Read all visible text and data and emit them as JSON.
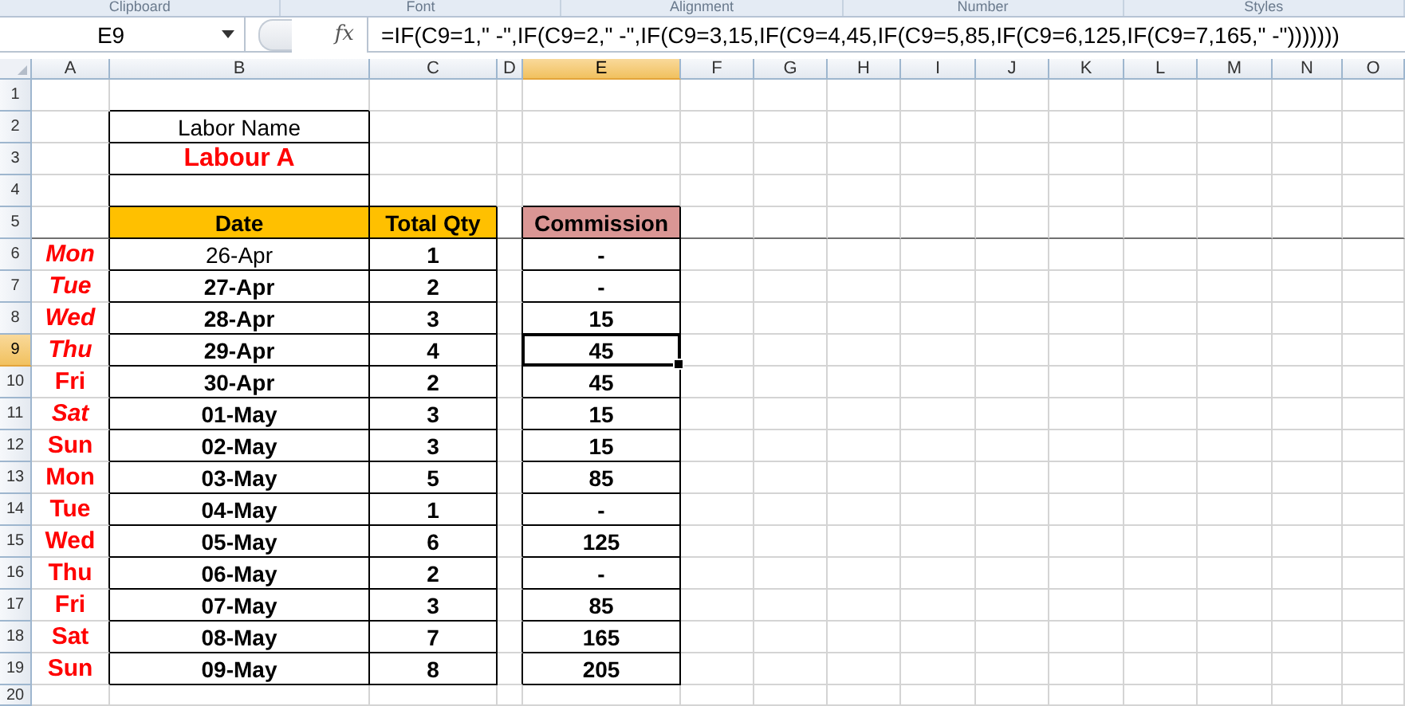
{
  "ribbon_groups": [
    "Clipboard",
    "Font",
    "Alignment",
    "Number",
    "Styles"
  ],
  "formula_bar": {
    "name_box": "E9",
    "fx_label": "fx",
    "formula": "=IF(C9=1,\" -\",IF(C9=2,\" -\",IF(C9=3,15,IF(C9=4,45,IF(C9=5,85,IF(C9=6,125,IF(C9=7,165,\" -\")))))))"
  },
  "columns": [
    {
      "label": "A",
      "selected": false
    },
    {
      "label": "B",
      "selected": false
    },
    {
      "label": "C",
      "selected": false
    },
    {
      "label": "D",
      "selected": false
    },
    {
      "label": "E",
      "selected": true
    },
    {
      "label": "F",
      "selected": false
    },
    {
      "label": "G",
      "selected": false
    },
    {
      "label": "H",
      "selected": false
    },
    {
      "label": "I",
      "selected": false
    },
    {
      "label": "J",
      "selected": false
    },
    {
      "label": "K",
      "selected": false
    },
    {
      "label": "L",
      "selected": false
    },
    {
      "label": "M",
      "selected": false
    },
    {
      "label": "N",
      "selected": false
    },
    {
      "label": "O",
      "selected": false
    }
  ],
  "rows": [
    {
      "label": "1",
      "selected": false
    },
    {
      "label": "2",
      "selected": false
    },
    {
      "label": "3",
      "selected": false
    },
    {
      "label": "4",
      "selected": false
    },
    {
      "label": "5",
      "selected": false
    },
    {
      "label": "6",
      "selected": false
    },
    {
      "label": "7",
      "selected": false
    },
    {
      "label": "8",
      "selected": false
    },
    {
      "label": "9",
      "selected": true
    },
    {
      "label": "10",
      "selected": false
    },
    {
      "label": "11",
      "selected": false
    },
    {
      "label": "12",
      "selected": false
    },
    {
      "label": "13",
      "selected": false
    },
    {
      "label": "14",
      "selected": false
    },
    {
      "label": "15",
      "selected": false
    },
    {
      "label": "16",
      "selected": false
    },
    {
      "label": "17",
      "selected": false
    },
    {
      "label": "18",
      "selected": false
    },
    {
      "label": "19",
      "selected": false
    },
    {
      "label": "20",
      "selected": false
    }
  ],
  "sheet": {
    "labor_name_label": "Labor Name",
    "labor_name": "Labour A",
    "headers": {
      "date": "Date",
      "total_qty": "Total Qty",
      "commission": "Commission"
    },
    "entries": [
      {
        "day": "Mon",
        "day_italic": true,
        "date": "26-Apr",
        "date_bold": false,
        "qty": "1",
        "commission": "-",
        "selected": false
      },
      {
        "day": "Tue",
        "day_italic": true,
        "date": "27-Apr",
        "date_bold": true,
        "qty": "2",
        "commission": "-",
        "selected": false
      },
      {
        "day": "Wed",
        "day_italic": true,
        "date": "28-Apr",
        "date_bold": true,
        "qty": "3",
        "commission": "15",
        "selected": false
      },
      {
        "day": "Thu",
        "day_italic": true,
        "date": "29-Apr",
        "date_bold": true,
        "qty": "4",
        "commission": "45",
        "selected": true
      },
      {
        "day": "Fri",
        "day_italic": false,
        "date": "30-Apr",
        "date_bold": true,
        "qty": "2",
        "commission": "45",
        "selected": false
      },
      {
        "day": "Sat",
        "day_italic": true,
        "date": "01-May",
        "date_bold": true,
        "qty": "3",
        "commission": "15",
        "selected": false
      },
      {
        "day": "Sun",
        "day_italic": false,
        "date": "02-May",
        "date_bold": true,
        "qty": "3",
        "commission": "15",
        "selected": false
      },
      {
        "day": "Mon",
        "day_italic": false,
        "date": "03-May",
        "date_bold": true,
        "qty": "5",
        "commission": "85",
        "selected": false
      },
      {
        "day": "Tue",
        "day_italic": false,
        "date": "04-May",
        "date_bold": true,
        "qty": "1",
        "commission": "-",
        "selected": false
      },
      {
        "day": "Wed",
        "day_italic": false,
        "date": "05-May",
        "date_bold": true,
        "qty": "6",
        "commission": "125",
        "selected": false
      },
      {
        "day": "Thu",
        "day_italic": false,
        "date": "06-May",
        "date_bold": true,
        "qty": "2",
        "commission": "-",
        "selected": false
      },
      {
        "day": "Fri",
        "day_italic": false,
        "date": "07-May",
        "date_bold": true,
        "qty": "3",
        "commission": "85",
        "selected": false
      },
      {
        "day": "Sat",
        "day_italic": false,
        "date": "08-May",
        "date_bold": true,
        "qty": "7",
        "commission": "165",
        "selected": false
      },
      {
        "day": "Sun",
        "day_italic": false,
        "date": "09-May",
        "date_bold": true,
        "qty": "8",
        "commission": "205",
        "selected": false
      }
    ]
  }
}
